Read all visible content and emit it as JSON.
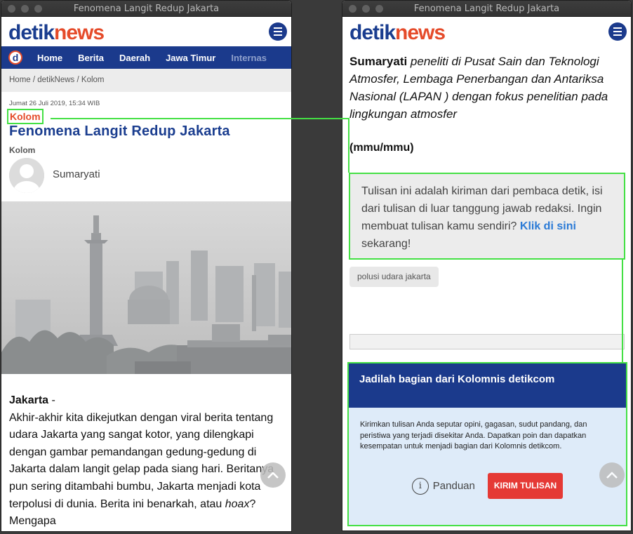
{
  "window_title": "Fenomena Langit Redup Jakarta",
  "logo": {
    "part1": "detik",
    "part2": "news"
  },
  "nav": {
    "logo_letter": "d",
    "items": [
      "Home",
      "Berita",
      "Daerah",
      "Jawa Timur",
      "Internas"
    ]
  },
  "breadcrumb": "Home / detikNews / Kolom",
  "article": {
    "date": "Jumat 26 Juli 2019, 15:34 WIB",
    "category": "Kolom",
    "title": "Fenomena Langit Redup Jakarta",
    "section": "Kolom",
    "author": "Sumaryati",
    "lead_city": "Jakarta",
    "lead_dash": " -",
    "body_1": "Akhir-akhir kita dikejutkan dengan viral berita tentang udara Jakarta yang sangat kotor, yang dilengkapi dengan gambar pemandangan gedung-gedung di Jakarta dalam langit gelap pada siang hari. Beritanya pun sering ditambahi bumbu, Jakarta menjadi kota terpolusi di dunia. Berita ini benarkah, atau ",
    "body_hoax": "hoax",
    "body_2": "? Mengapa"
  },
  "author_bio": {
    "name": "Sumaryati",
    "desc": " peneliti di Pusat Sain dan Teknologi Atmosfer, Lembaga Penerbangan dan Antariksa Nasional (LAPAN ) dengan fokus penelitian pada lingkungan atmosfer",
    "code": "(mmu/mmu)"
  },
  "notice": {
    "text": "Tulisan ini adalah kiriman dari pembaca detik, isi dari tulisan di luar tanggung jawab redaksi. Ingin membuat tulisan kamu sendiri? ",
    "link": "Klik di sini",
    "after": " sekarang!"
  },
  "tag": "polusi udara jakarta",
  "kolomnis": {
    "title": "Jadilah bagian dari Kolomnis detikcom",
    "body": "Kirimkan tulisan Anda seputar opini, gagasan, sudut pandang, dan peristiwa yang terjadi disekitar Anda. Dapatkan poin dan dapatkan kesempatan untuk menjadi bagian dari Kolomnis detikcom.",
    "guide_label": "Panduan",
    "info_glyph": "i",
    "submit_label": "KIRIM TULISAN"
  },
  "colors": {
    "brand_blue": "#1b3a8c",
    "brand_orange": "#e54b2a",
    "highlight_green": "#44e044",
    "button_red": "#e53935"
  }
}
